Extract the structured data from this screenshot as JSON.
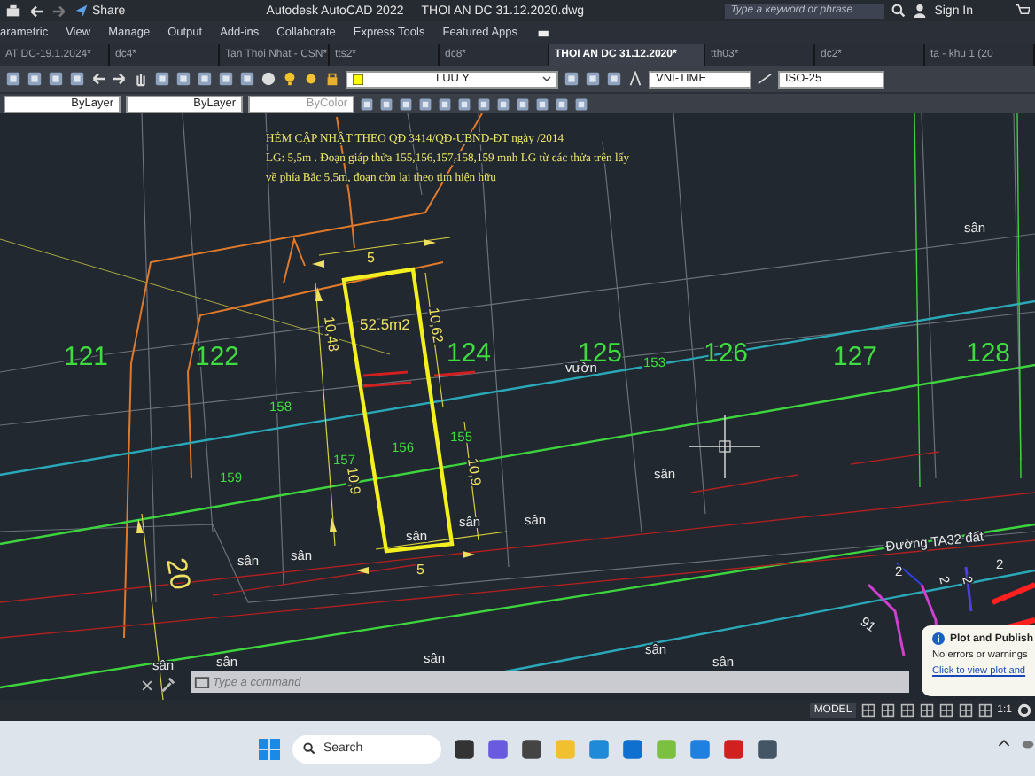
{
  "title_bar": {
    "share": "Share",
    "app": "Autodesk AutoCAD 2022",
    "file": "THOI AN DC 31.12.2020.dwg",
    "search_placeholder": "Type a keyword or phrase",
    "sign_in": "Sign In"
  },
  "ribbon_tabs": [
    "arametric",
    "View",
    "Manage",
    "Output",
    "Add-ins",
    "Collaborate",
    "Express Tools",
    "Featured Apps"
  ],
  "file_tabs": [
    {
      "label": "AT DC-19.1.2024*",
      "selected": false
    },
    {
      "label": "dc4*",
      "selected": false
    },
    {
      "label": "Tan Thoi Nhat - CSN*",
      "selected": false
    },
    {
      "label": "tts2*",
      "selected": false
    },
    {
      "label": "dc8*",
      "selected": false
    },
    {
      "label": "THOI AN DC 31.12.2020*",
      "selected": true
    },
    {
      "label": "tth03*",
      "selected": false
    },
    {
      "label": "dc2*",
      "selected": false
    },
    {
      "label": "ta - khu 1 (20",
      "selected": false
    }
  ],
  "toolbar": {
    "layer": "LUU Y",
    "text_style": "VNI-TIME",
    "dim_style": "ISO-25"
  },
  "properties": [
    "ByLayer",
    "ByLayer",
    "ByColor"
  ],
  "drawing": {
    "note_lines": [
      "HẺM CẬP NHẬT THEO QĐ 3414/QĐ-UBND-ĐT ngày /2014",
      "LG: 5,5m . Đoạn giáp thửa 155,156,157,158,159 mnh LG từ các thửa trên lấy",
      "về phía Bắc 5,5m, đoạn còn lại theo tim hiện hữu"
    ],
    "labels": [
      {
        "text": "121",
        "kind": "parcel"
      },
      {
        "text": "122",
        "kind": "parcel"
      },
      {
        "text": "124",
        "kind": "parcel"
      },
      {
        "text": "125",
        "kind": "parcel"
      },
      {
        "text": "126",
        "kind": "parcel"
      },
      {
        "text": "127",
        "kind": "parcel"
      },
      {
        "text": "128",
        "kind": "parcel"
      },
      {
        "text": "158",
        "kind": "lot"
      },
      {
        "text": "159",
        "kind": "lot"
      },
      {
        "text": "157",
        "kind": "lot"
      },
      {
        "text": "156",
        "kind": "lot"
      },
      {
        "text": "155",
        "kind": "lot"
      },
      {
        "text": "153",
        "kind": "lot"
      },
      {
        "text": "vườn",
        "kind": "plain"
      },
      {
        "text": "5",
        "kind": "dimension"
      },
      {
        "text": "52.5m2",
        "kind": "dimension"
      },
      {
        "text": "5",
        "kind": "dimension"
      },
      {
        "text": "10,48",
        "kind": "dimension"
      },
      {
        "text": "10,62",
        "kind": "dimension"
      },
      {
        "text": "10,9",
        "kind": "dimension"
      },
      {
        "text": "10,9",
        "kind": "dimension"
      },
      {
        "text": "20",
        "kind": "dimension"
      },
      {
        "text": "sân",
        "kind": "plain"
      },
      {
        "text": "sân",
        "kind": "plain"
      },
      {
        "text": "sân",
        "kind": "plain"
      },
      {
        "text": "sân",
        "kind": "plain"
      },
      {
        "text": "sân",
        "kind": "plain"
      },
      {
        "text": "sân",
        "kind": "plain"
      },
      {
        "text": "sân",
        "kind": "plain"
      },
      {
        "text": "sân",
        "kind": "plain"
      },
      {
        "text": "sân",
        "kind": "plain"
      },
      {
        "text": "sân",
        "kind": "plain"
      },
      {
        "text": "sân",
        "kind": "plain"
      },
      {
        "text": "sân",
        "kind": "plain"
      },
      {
        "text": "Đường TA32 đất",
        "kind": "plain"
      },
      {
        "text": "2",
        "kind": "plain"
      },
      {
        "text": "2",
        "kind": "plain"
      },
      {
        "text": "2",
        "kind": "plain"
      },
      {
        "text": "2",
        "kind": "plain"
      },
      {
        "text": "91",
        "kind": "plain"
      }
    ]
  },
  "notification": {
    "title": "Plot and Publish",
    "message": "No errors or warnings",
    "link": "Click to view plot and"
  },
  "command_line": {
    "placeholder": "Type a command"
  },
  "status_bar": {
    "mode": "MODEL",
    "scale": "1:1"
  },
  "taskbar": {
    "search": "Search"
  }
}
